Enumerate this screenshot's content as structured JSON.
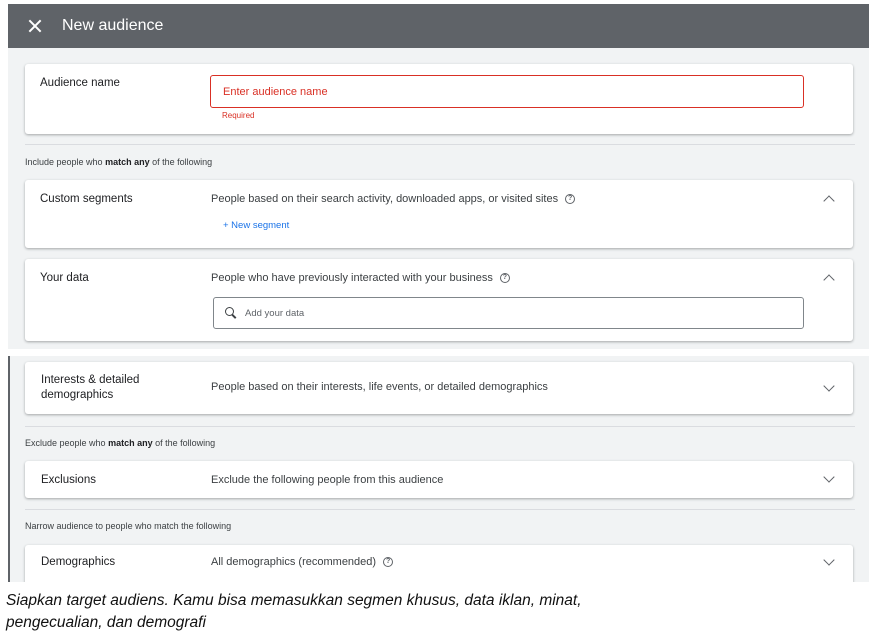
{
  "header": {
    "title": "New audience"
  },
  "audience_name": {
    "label": "Audience name",
    "placeholder": "Enter audience name",
    "error": "Required"
  },
  "include": {
    "note_prefix": "Include people who ",
    "note_bold": "match any",
    "note_suffix": " of the following"
  },
  "custom_segments": {
    "label": "Custom segments",
    "description": "People based on their search activity, downloaded apps, or visited sites",
    "link": "+ New segment"
  },
  "your_data": {
    "label": "Your data",
    "description": "People who have previously interacted with your business",
    "search_placeholder": "Add your data"
  },
  "interests": {
    "label_line1": "Interests & detailed",
    "label_line2": "demographics",
    "description": "People based on their interests, life events, or detailed demographics"
  },
  "exclude": {
    "note_prefix": "Exclude people who ",
    "note_bold": "match any",
    "note_suffix": " of the following"
  },
  "exclusions": {
    "label": "Exclusions",
    "description": "Exclude the following people from this audience"
  },
  "narrow": {
    "note": "Narrow audience to people who match the following"
  },
  "demographics": {
    "label": "Demographics",
    "description": "All demographics (recommended)"
  },
  "caption": {
    "line1": "Siapkan target audiens. Kamu bisa memasukkan segmen khusus, data iklan, minat,",
    "line2": "pengecualian, dan demografi"
  },
  "colors": {
    "header_bg": "#5f6368",
    "error": "#d93025",
    "link": "#1a73e8",
    "page_bg": "#f1f3f4"
  }
}
